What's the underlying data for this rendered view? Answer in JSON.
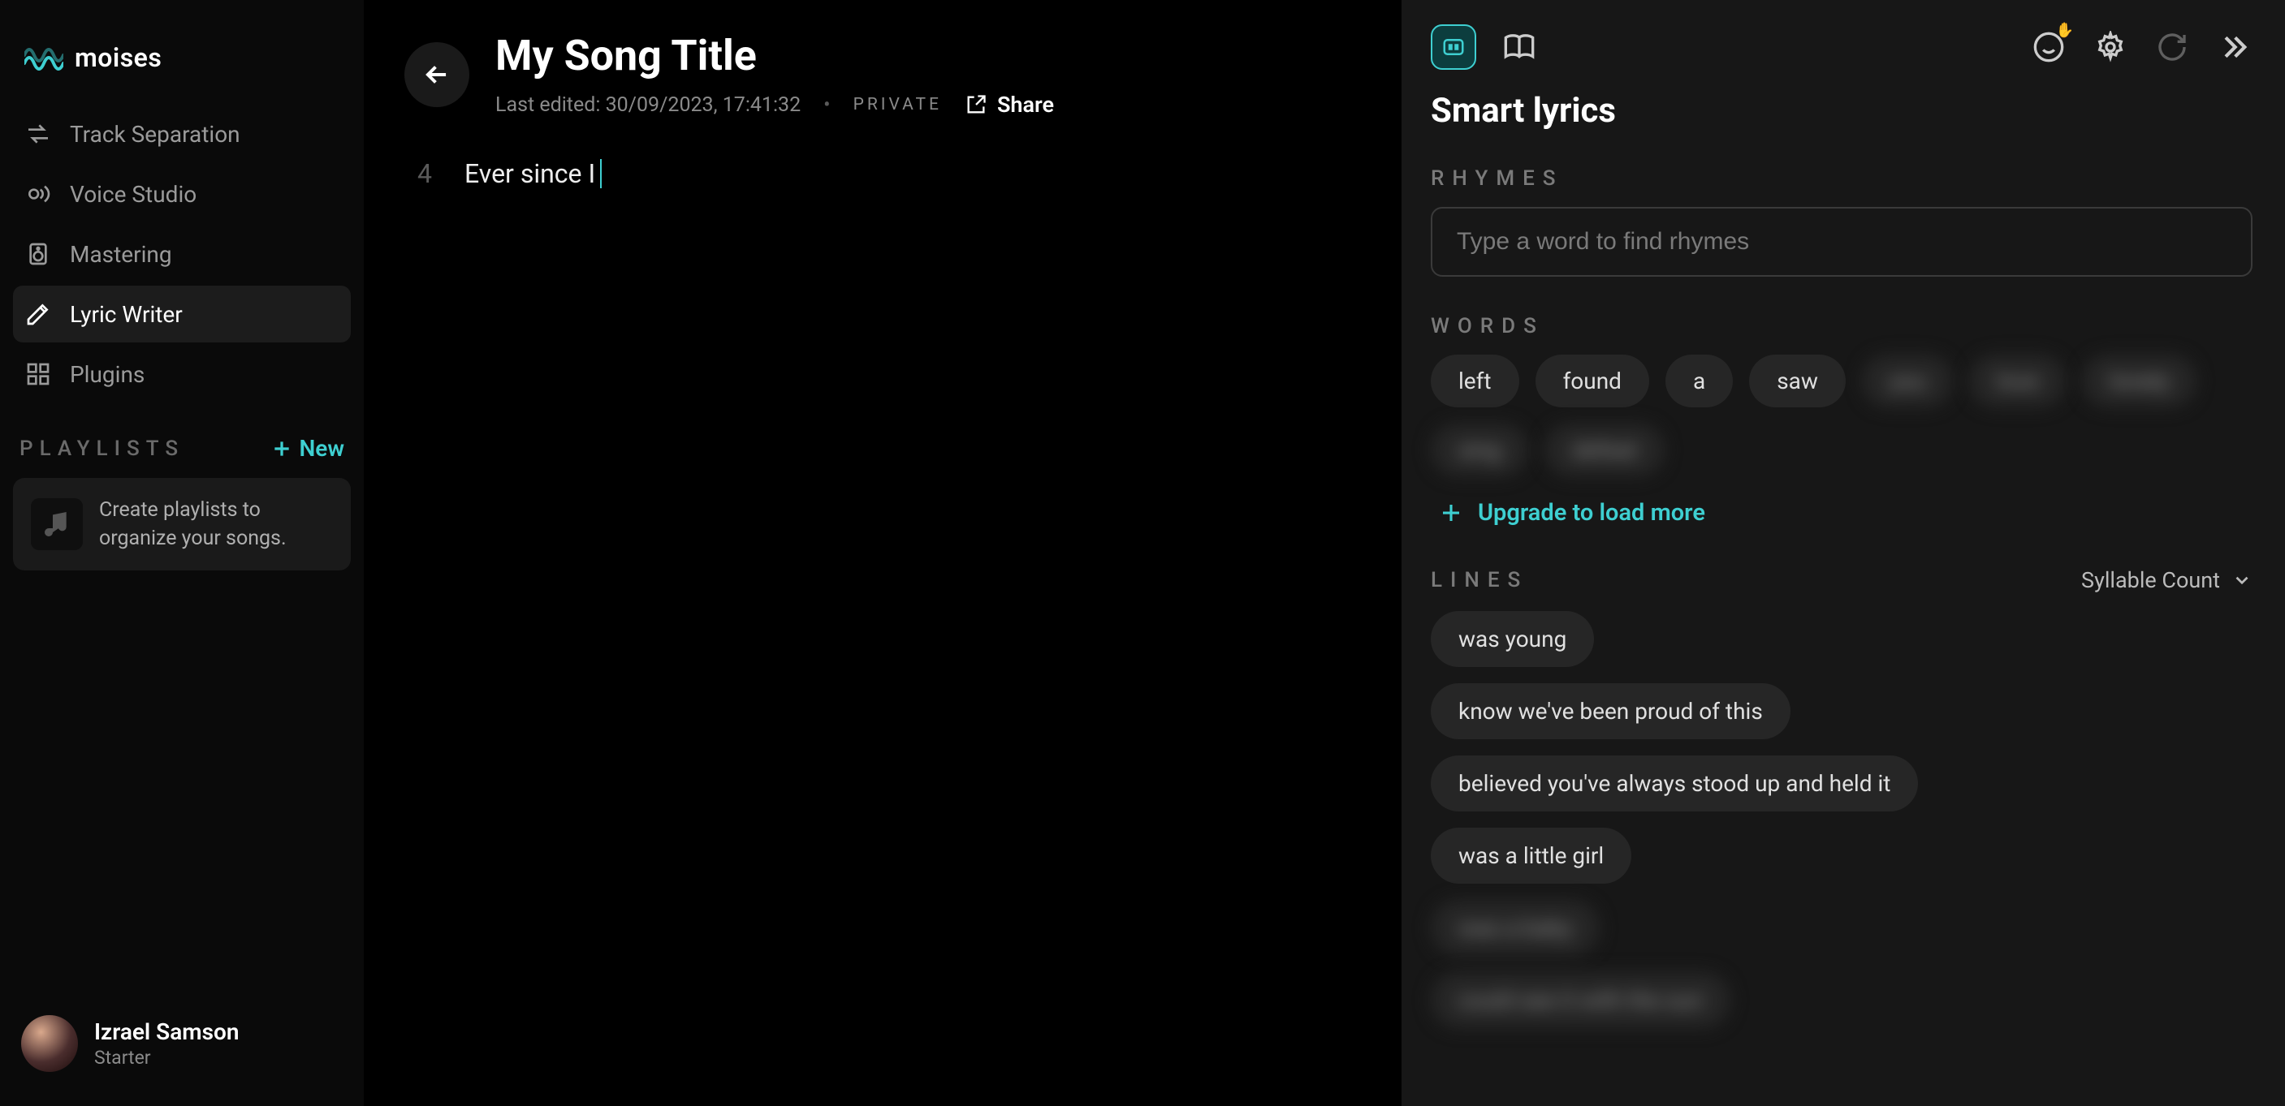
{
  "brand": "moises",
  "sidebar": {
    "nav": [
      {
        "label": "Track Separation",
        "icon": "swap"
      },
      {
        "label": "Voice Studio",
        "icon": "voice"
      },
      {
        "label": "Mastering",
        "icon": "speaker"
      },
      {
        "label": "Lyric Writer",
        "icon": "pen"
      },
      {
        "label": "Plugins",
        "icon": "grid"
      }
    ],
    "playlists_label": "PLAYLISTS",
    "new_label": "New",
    "playlist_empty": "Create playlists to organize your songs."
  },
  "user": {
    "name": "Izrael Samson",
    "tier": "Starter"
  },
  "editor": {
    "title": "My Song Title",
    "last_edited": "Last edited: 30/09/2023, 17:41:32",
    "privacy": "PRIVATE",
    "share_label": "Share",
    "line_num": "4",
    "line_text": "Ever since I"
  },
  "panel": {
    "title": "Smart lyrics",
    "rhymes_label": "RHYMES",
    "rhymes_placeholder": "Type a word to find rhymes",
    "words_label": "WORDS",
    "words": [
      "left",
      "found",
      "a",
      "saw"
    ],
    "words_locked": [
      "you",
      "love",
      "lonely",
      "sing",
      "defeat"
    ],
    "upgrade_label": "Upgrade to load more",
    "lines_label": "LINES",
    "syllable_label": "Syllable Count",
    "lines": [
      "was young",
      "know we've been proud of this",
      "believed you've always stood up and held it",
      "was a little girl"
    ],
    "lines_locked": [
      "was a baby",
      "could see it with the sun"
    ]
  }
}
